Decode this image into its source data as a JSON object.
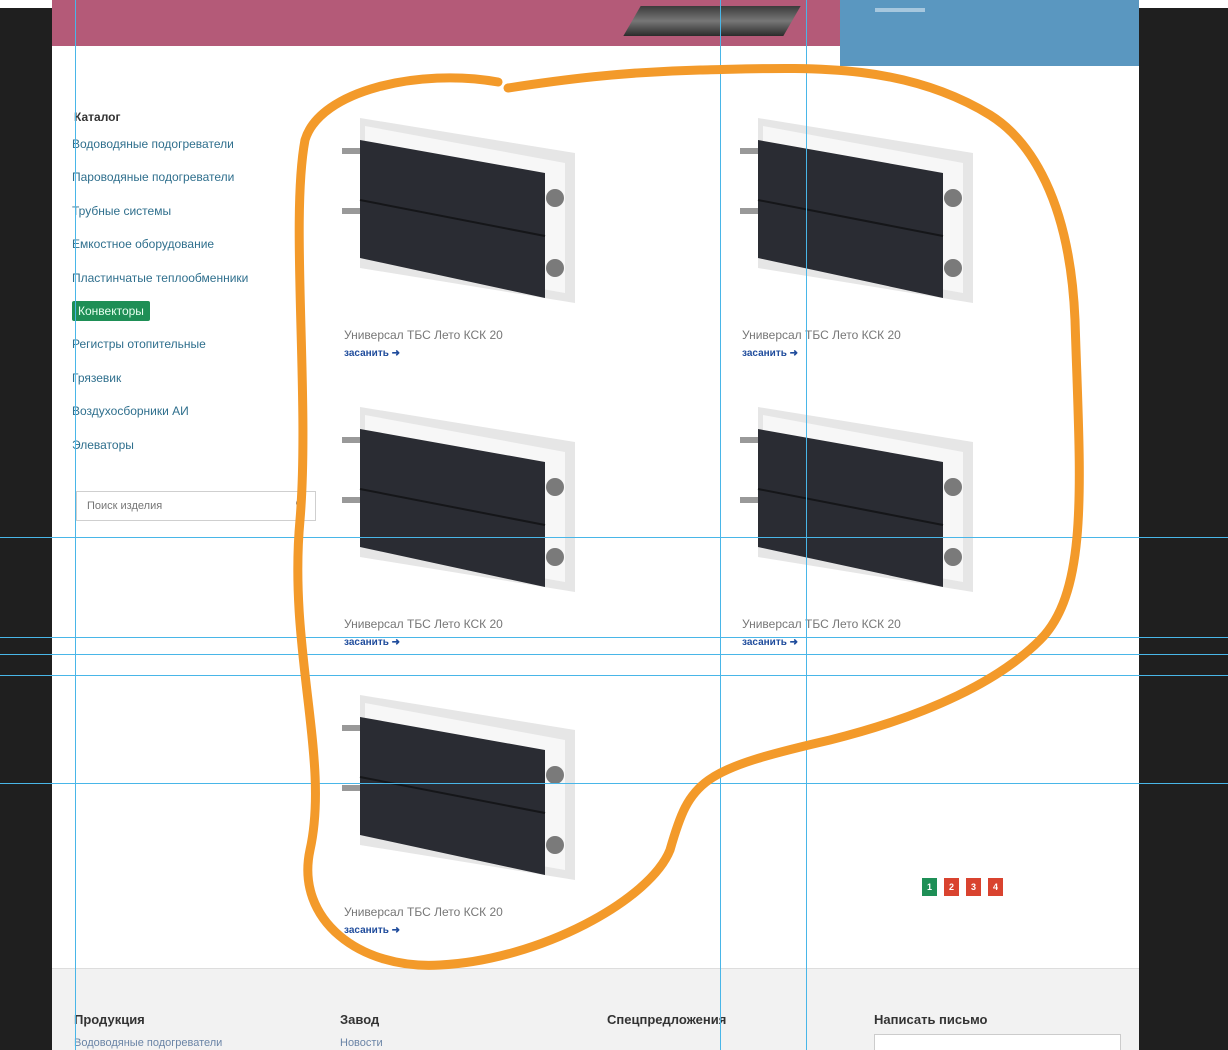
{
  "sidebar": {
    "title": "Каталог",
    "items": [
      {
        "label": "Водоводяные подогреватели"
      },
      {
        "label": "Пароводяные подогреватели"
      },
      {
        "label": "Трубные системы"
      },
      {
        "label": "Емкостное оборудование"
      },
      {
        "label": "Пластинчатые теплообменники"
      },
      {
        "label": "Конвекторы",
        "active": true
      },
      {
        "label": "Регистры отопительные"
      },
      {
        "label": "Грязевик"
      },
      {
        "label": "Воздухосборники АИ"
      },
      {
        "label": "Элеваторы"
      }
    ]
  },
  "search": {
    "placeholder": "Поиск изделия"
  },
  "products": [
    {
      "name": "Универсал ТБС Лето КСК 20",
      "more": "засанить ➜"
    },
    {
      "name": "Универсал ТБС Лето КСК 20",
      "more": "засанить ➜"
    },
    {
      "name": "Универсал ТБС Лето КСК 20",
      "more": "засанить ➜"
    },
    {
      "name": "Универсал ТБС Лето КСК 20",
      "more": "засанить ➜"
    },
    {
      "name": "Универсал ТБС Лето КСК 20",
      "more": "засанить ➜"
    }
  ],
  "pagination": {
    "pages": [
      "1",
      "2",
      "3",
      "4"
    ],
    "current": "1",
    "colors": {
      "active": "#1e8f56",
      "inactive": "#d9432f"
    }
  },
  "footer": {
    "columns": [
      {
        "heading": "Продукция",
        "link": "Водоводяные подогреватели"
      },
      {
        "heading": "Завод",
        "link": "Новости"
      },
      {
        "heading": "Спецпредложения",
        "link": ""
      },
      {
        "heading": "Написать письмо",
        "link": ""
      }
    ]
  },
  "colors": {
    "banner_pink": "#b45a78",
    "banner_blue": "#5a97c0",
    "annotation_stroke": "#f39a2a",
    "guides": "#49b6e8"
  }
}
